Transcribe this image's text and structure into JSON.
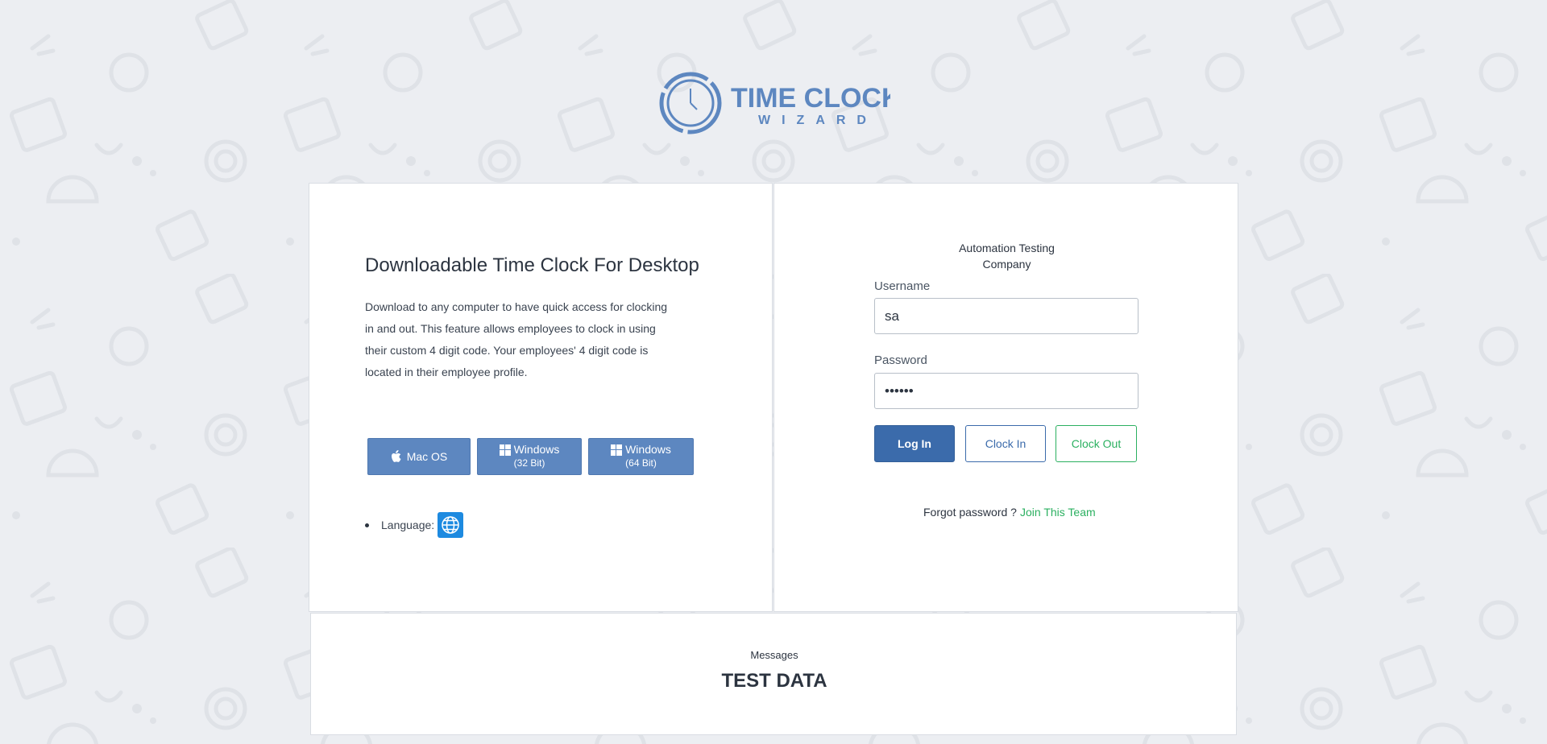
{
  "brand": {
    "logo_line1": "TIME CLOCK",
    "logo_line2": "WIZARD",
    "color": "#5d87c0"
  },
  "download_panel": {
    "title": "Downloadable Time Clock For Desktop",
    "description": "Download to any computer to have quick access for clocking in and out. This feature allows employees to clock in using their custom 4 digit code. Your employees' 4 digit code is located in their employee profile.",
    "buttons": {
      "mac": {
        "label": "Mac OS",
        "icon": "apple-icon"
      },
      "win32": {
        "label": "Windows",
        "sub": "(32 Bit)",
        "icon": "windows-icon"
      },
      "win64": {
        "label": "Windows",
        "sub": "(64 Bit)",
        "icon": "windows-icon"
      }
    },
    "language_label": "Language:",
    "language_icon": "globe-icon"
  },
  "login_panel": {
    "company_line1": "Automation Testing",
    "company_line2": "Company",
    "username_label": "Username",
    "username_value": "sa",
    "password_label": "Password",
    "password_value": "••••••",
    "login_label": "Log In",
    "clock_in_label": "Clock In",
    "clock_out_label": "Clock Out",
    "forgot_label": "Forgot password ?",
    "join_label": "Join This Team"
  },
  "messages": {
    "label": "Messages",
    "body": "TEST DATA"
  },
  "colors": {
    "primary": "#3b6bab",
    "download_button": "#5d87c0",
    "success": "#2bb060",
    "background": "#eceef2",
    "globe": "#1d8ae0"
  }
}
